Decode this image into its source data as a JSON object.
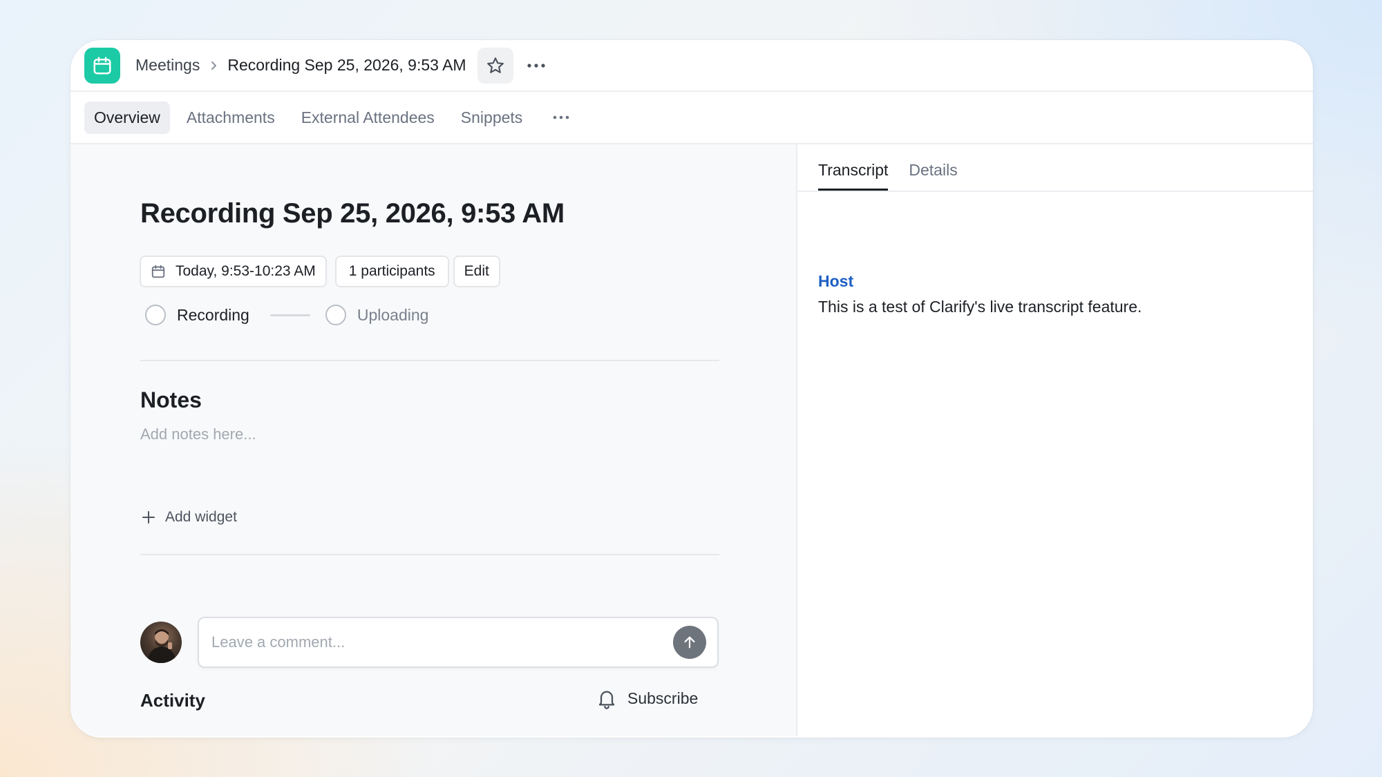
{
  "header": {
    "breadcrumb_parent": "Meetings",
    "breadcrumb_current": "Recording Sep 25, 2026, 9:53 AM"
  },
  "tabs": [
    {
      "label": "Overview",
      "active": true
    },
    {
      "label": "Attachments",
      "active": false
    },
    {
      "label": "External Attendees",
      "active": false
    },
    {
      "label": "Snippets",
      "active": false
    }
  ],
  "main": {
    "title": "Recording Sep 25, 2026, 9:53 AM",
    "time_pill": "Today, 9:53-10:23 AM",
    "participants_pill": "1 participants",
    "edit_label": "Edit",
    "steps": [
      {
        "label": "Recording"
      },
      {
        "label": "Uploading"
      }
    ],
    "notes_heading": "Notes",
    "notes_placeholder": "Add notes here...",
    "add_widget_label": "Add widget",
    "comment_placeholder": "Leave a comment...",
    "activity_heading": "Activity",
    "subscribe_label": "Subscribe"
  },
  "side_panel": {
    "tabs": [
      {
        "label": "Transcript",
        "active": true
      },
      {
        "label": "Details",
        "active": false
      }
    ],
    "transcript": [
      {
        "speaker": "Host",
        "text": "This is a test of Clarify's live transcript feature."
      }
    ]
  },
  "colors": {
    "app_icon": "#1ccaa6",
    "speaker": "#1d5fc4",
    "send_button": "#6e747c"
  },
  "icons": [
    "calendar-icon",
    "chevron-right-icon",
    "star-icon",
    "more-horizontal-icon",
    "plus-icon",
    "arrow-up-icon",
    "bell-icon"
  ]
}
